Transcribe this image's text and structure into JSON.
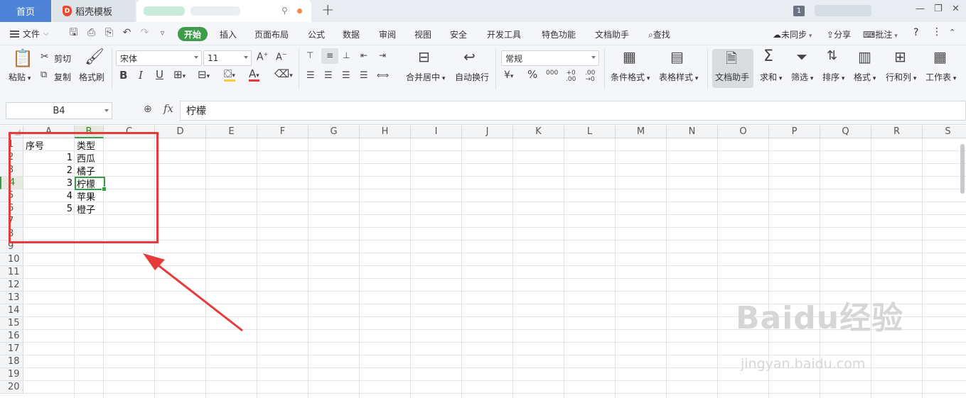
{
  "tabs": {
    "home": "首页",
    "template": "稻壳模板",
    "new_tab": "+",
    "window_count": "1"
  },
  "menu": {
    "file": "文件",
    "items": [
      "开始",
      "插入",
      "页面布局",
      "公式",
      "数据",
      "审阅",
      "视图",
      "安全",
      "开发工具",
      "特色功能",
      "文档助手",
      "查找"
    ],
    "sync": "未同步",
    "share": "分享",
    "comment": "批注"
  },
  "ribbon": {
    "paste": "粘贴",
    "cut": "剪切",
    "copy": "复制",
    "format_painter": "格式刷",
    "font_name": "宋体",
    "font_size": "11",
    "merge_center": "合并居中",
    "wrap_text": "自动换行",
    "number_format": "常规",
    "conditional_format": "条件格式",
    "table_style": "表格样式",
    "doc_assistant": "文档助手",
    "sum": "求和",
    "filter": "筛选",
    "sort": "排序",
    "format": "格式",
    "rows_cols": "行和列",
    "worksheet": "工作表"
  },
  "formula_bar": {
    "cell_ref": "B4",
    "fx": "fx",
    "content": "柠檬"
  },
  "sheet": {
    "columns": [
      "A",
      "B",
      "C",
      "D",
      "E",
      "F",
      "G",
      "H",
      "I",
      "J",
      "K",
      "L",
      "M",
      "N",
      "O",
      "P",
      "Q",
      "R",
      "S"
    ],
    "rows": [
      "1",
      "2",
      "3",
      "4",
      "5",
      "6",
      "7",
      "8",
      "9",
      "10",
      "11",
      "12",
      "13",
      "14",
      "15",
      "16",
      "17",
      "18",
      "19",
      "20"
    ],
    "cells": {
      "A1": "序号",
      "B1": "类型",
      "A2": "1",
      "B2": "西瓜",
      "A3": "2",
      "B3": "橘子",
      "A4": "3",
      "B4": "柠檬",
      "A5": "4",
      "B5": "苹果",
      "A6": "5",
      "B6": "橙子"
    },
    "selected_cell": "B4"
  },
  "watermark": {
    "main": "Baidu经验",
    "sub": "jingyan.baidu.com"
  },
  "colors": {
    "accent_green": "#3a9c48",
    "tab_blue": "#4e83d8",
    "annotation_red": "#e53b3b"
  }
}
